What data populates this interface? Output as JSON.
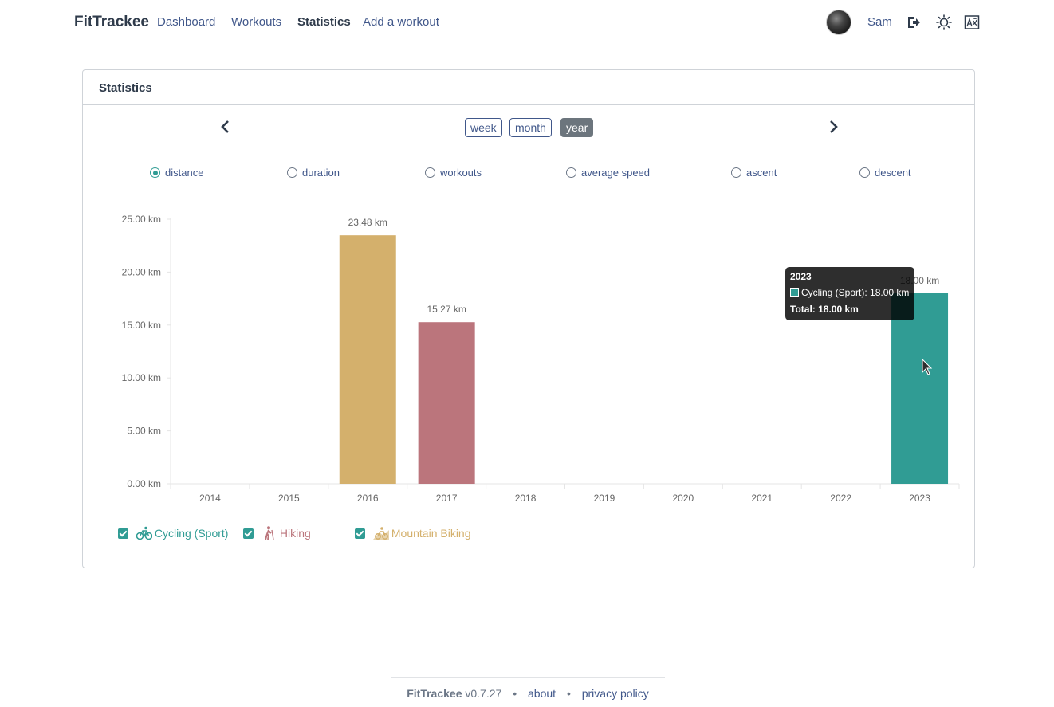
{
  "navbar": {
    "brand": "FitTrackee",
    "links": [
      "Dashboard",
      "Workouts",
      "Statistics",
      "Add a workout"
    ],
    "active_link": "Statistics",
    "username": "Sam",
    "icons": [
      "logout-icon",
      "sun-icon",
      "language-icon"
    ]
  },
  "card": {
    "title": "Statistics",
    "periods": [
      "week",
      "month",
      "year"
    ],
    "active_period": "year",
    "metrics": [
      "distance",
      "duration",
      "workouts",
      "average speed",
      "ascent",
      "descent"
    ],
    "selected_metric": "distance"
  },
  "chart_data": {
    "type": "bar",
    "stacked": true,
    "categories": [
      "2014",
      "2015",
      "2016",
      "2017",
      "2018",
      "2019",
      "2020",
      "2021",
      "2022",
      "2023"
    ],
    "series": [
      {
        "name": "Cycling (Sport)",
        "color": "#309c94",
        "values": [
          0,
          0,
          0,
          0,
          0,
          0,
          0,
          0,
          0,
          18.0
        ]
      },
      {
        "name": "Hiking",
        "color": "#bb757c",
        "values": [
          0,
          0,
          0,
          15.27,
          0,
          0,
          0,
          0,
          0,
          0
        ]
      },
      {
        "name": "Mountain Biking",
        "color": "#d4b06c",
        "values": [
          0,
          0,
          23.48,
          0,
          0,
          0,
          0,
          0,
          0,
          0
        ]
      }
    ],
    "total_labels": [
      "",
      "",
      "23.48 km",
      "15.27 km",
      "",
      "",
      "",
      "",
      "",
      "18.00 km"
    ],
    "y_ticks": [
      "0.00 km",
      "5.00 km",
      "10.00 km",
      "15.00 km",
      "20.00 km",
      "25.00 km"
    ],
    "ylim": [
      0,
      25
    ],
    "grid": false
  },
  "tooltip": {
    "title": "2023",
    "line": "Cycling (Sport): 18.00 km",
    "total": "Total: 18.00 km"
  },
  "legend": [
    {
      "label": "Cycling (Sport)",
      "icon": "cycling-icon",
      "color": "#309c94",
      "checked": true
    },
    {
      "label": "Hiking",
      "icon": "hiking-icon",
      "color": "#bb757c",
      "checked": true
    },
    {
      "label": "Mountain Biking",
      "icon": "mountain-biking-icon",
      "color": "#d4b06c",
      "checked": true
    }
  ],
  "footer": {
    "app": "FitTrackee",
    "version": "v0.7.27",
    "separator": "•",
    "about": "about",
    "privacy": "privacy policy"
  }
}
